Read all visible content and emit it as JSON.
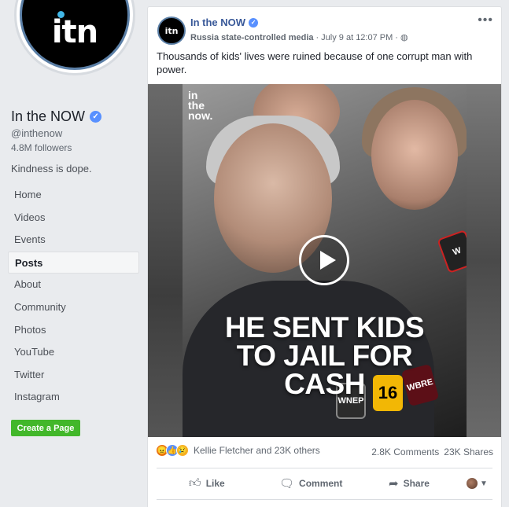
{
  "page": {
    "logo_text": "itn",
    "name": "In the NOW",
    "handle": "@inthenow",
    "followers": "4.8M followers",
    "tagline": "Kindness is dope.",
    "create_button": "Create a Page"
  },
  "nav": {
    "items": [
      {
        "label": "Home"
      },
      {
        "label": "Videos"
      },
      {
        "label": "Events"
      },
      {
        "label": "Posts"
      },
      {
        "label": "About"
      },
      {
        "label": "Community"
      },
      {
        "label": "Photos"
      },
      {
        "label": "YouTube"
      },
      {
        "label": "Twitter"
      },
      {
        "label": "Instagram"
      }
    ],
    "active": "Posts"
  },
  "post": {
    "avatar_text": "itn",
    "author": "In the NOW",
    "state_label": "Russia state-controlled media",
    "separator": "·",
    "date": "July 9 at 12:07 PM",
    "separator2": "·",
    "more": "•••",
    "text": "Thousands of kids' lives were ruined because of one corrupt man with power.",
    "video": {
      "watermark_line1": "in",
      "watermark_line2": "the",
      "watermark_line3": "now.",
      "headline_line1": "HE SENT KIDS",
      "headline_line2": "TO JAIL FOR",
      "headline_line3": "CASH",
      "mic_labels": [
        "WNEP",
        "16",
        "WBRE",
        "W"
      ]
    },
    "reactions": {
      "types": [
        "angry",
        "like",
        "sad"
      ],
      "names": "Kellie Fletcher and 23K others",
      "comments": "2.8K Comments",
      "shares": "23K Shares"
    },
    "actions": {
      "like": "Like",
      "comment": "Comment",
      "share": "Share"
    }
  },
  "colors": {
    "link_blue": "#385898",
    "verified_blue": "#5890ff",
    "create_green": "#42b72a",
    "logo_dot": "#41b6e6"
  }
}
